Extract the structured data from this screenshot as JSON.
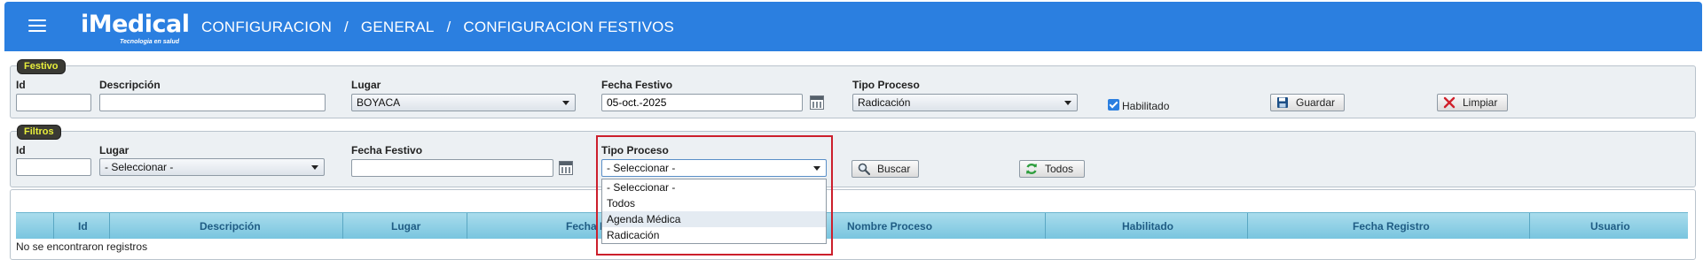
{
  "header": {
    "logo_text": "iMedical",
    "logo_tagline": "Tecnologia en salud",
    "breadcrumb": [
      "CONFIGURACION",
      "/",
      "GENERAL",
      "/",
      "CONFIGURACION FESTIVOS"
    ],
    "bar_color": "#2b7fe0"
  },
  "festivo": {
    "legend": "Festivo",
    "id_label": "Id",
    "id_value": "",
    "descripcion_label": "Descripción",
    "descripcion_value": "",
    "lugar_label": "Lugar",
    "lugar_value": "BOYACA",
    "fecha_label": "Fecha Festivo",
    "fecha_value": "05-oct.-2025",
    "tipo_label": "Tipo Proceso",
    "tipo_value": "Radicación",
    "habilitado_label": "Habilitado",
    "habilitado_checked": true,
    "guardar_label": "Guardar",
    "limpiar_label": "Limpiar"
  },
  "filtros": {
    "legend": "Filtros",
    "id_label": "Id",
    "id_value": "",
    "lugar_label": "Lugar",
    "lugar_value": "- Seleccionar -",
    "fecha_label": "Fecha Festivo",
    "fecha_value": "",
    "tipo_label": "Tipo Proceso",
    "tipo_value": "- Seleccionar -",
    "buscar_label": "Buscar",
    "todos_label": "Todos"
  },
  "tipo_dropdown": {
    "options": [
      "- Seleccionar -",
      "Todos",
      "Agenda Médica",
      "Radicación"
    ],
    "hovered_index": 2,
    "highlight_color": "#cc1f2c"
  },
  "grid": {
    "columns": [
      "Id",
      "Descripción",
      "Lugar",
      "Fecha Festivo",
      "Nombre Proceso",
      "Habilitado",
      "Fecha Registro",
      "Usuario"
    ],
    "empty_message": "No se encontraron registros"
  }
}
